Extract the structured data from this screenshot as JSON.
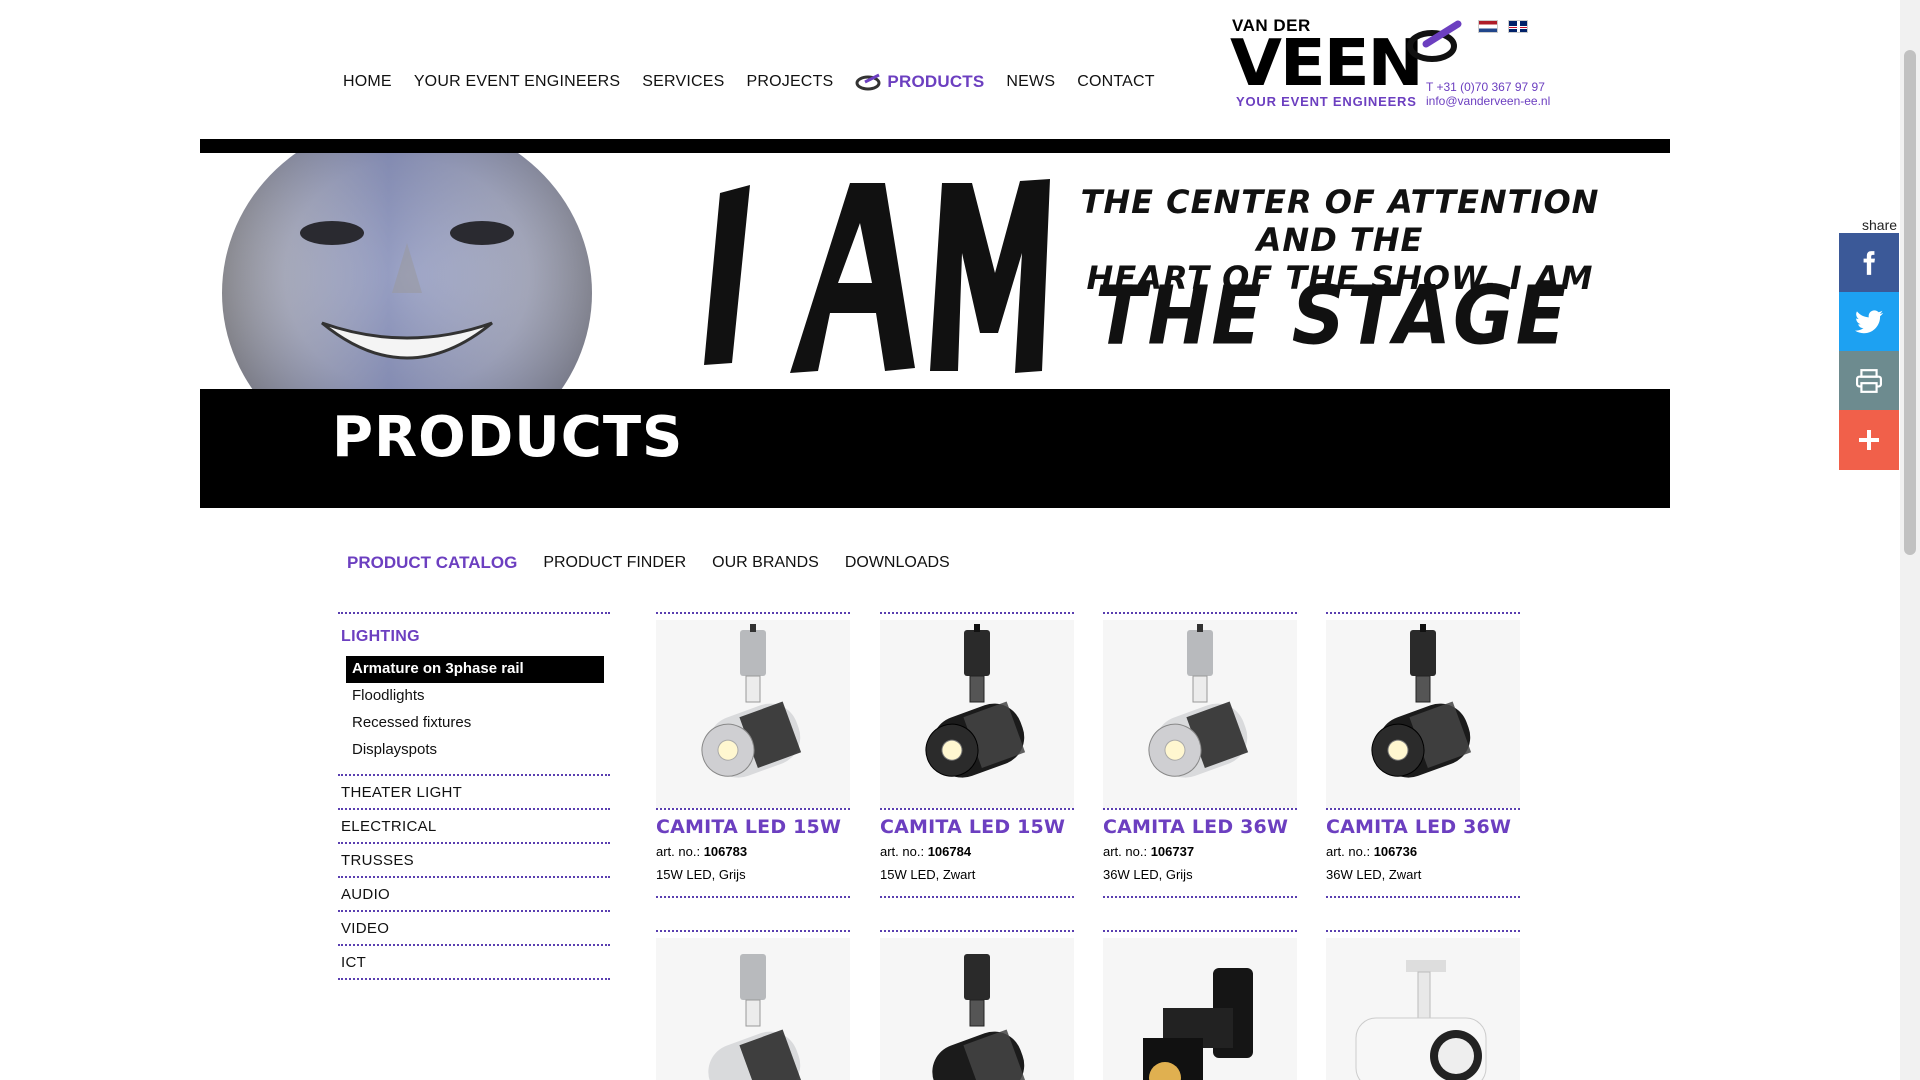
{
  "nav": {
    "items": [
      "HOME",
      "YOUR EVENT ENGINEERS",
      "SERVICES",
      "PROJECTS",
      "PRODUCTS",
      "NEWS",
      "CONTACT"
    ],
    "active": "PRODUCTS"
  },
  "logo": {
    "line1": "VAN DER",
    "line2": "VEEN",
    "tagline": "YOUR EVENT ENGINEERS"
  },
  "contact": {
    "phone": "T +31 (0)70 367 97 97",
    "email": "info@vanderveen-ee.nl"
  },
  "banner": {
    "big": "I AM",
    "line1": "THE CENTER OF ATTENTION AND THE",
    "line2": "HEART OF THE SHOW. I AM",
    "stage": "THE STAGE"
  },
  "page_title": "PRODUCTS",
  "subnav": {
    "items": [
      "PRODUCT CATALOG",
      "PRODUCT FINDER",
      "OUR BRANDS",
      "DOWNLOADS"
    ],
    "active": "PRODUCT CATALOG"
  },
  "sidebar": {
    "heading": "LIGHTING",
    "sub_items": [
      "Armature on 3phase rail",
      "Floodlights",
      "Recessed fixtures",
      "Displayspots"
    ],
    "categories": [
      "THEATER LIGHT",
      "ELECTRICAL",
      "TRUSSES",
      "AUDIO",
      "VIDEO",
      "ICT"
    ]
  },
  "products": [
    {
      "name": "CAMITA LED 15W",
      "art_label": "art. no.:",
      "art_no": "106783",
      "desc": "15W LED, Grijs",
      "color": "#d9dadc"
    },
    {
      "name": "CAMITA LED 15W",
      "art_label": "art. no.:",
      "art_no": "106784",
      "desc": "15W LED, Zwart",
      "color": "#1b1b1b"
    },
    {
      "name": "CAMITA LED 36W",
      "art_label": "art. no.:",
      "art_no": "106737",
      "desc": "36W LED, Grijs",
      "color": "#d9dadc"
    },
    {
      "name": "CAMITA LED 36W",
      "art_label": "art. no.:",
      "art_no": "106736",
      "desc": "36W LED, Zwart",
      "color": "#1b1b1b"
    }
  ],
  "products_row2_colors": [
    "#d9dadc",
    "#1b1b1b",
    "#111111",
    "#f2f2f2"
  ],
  "share": {
    "label": "share",
    "buttons": [
      "facebook-icon",
      "twitter-icon",
      "print-icon",
      "plus-icon"
    ]
  },
  "colors": {
    "accent": "#6c3fc0",
    "black": "#000000",
    "facebook": "#3b5998",
    "twitter": "#1da1f2",
    "print": "#6d8b8f",
    "more": "#f1604a"
  }
}
